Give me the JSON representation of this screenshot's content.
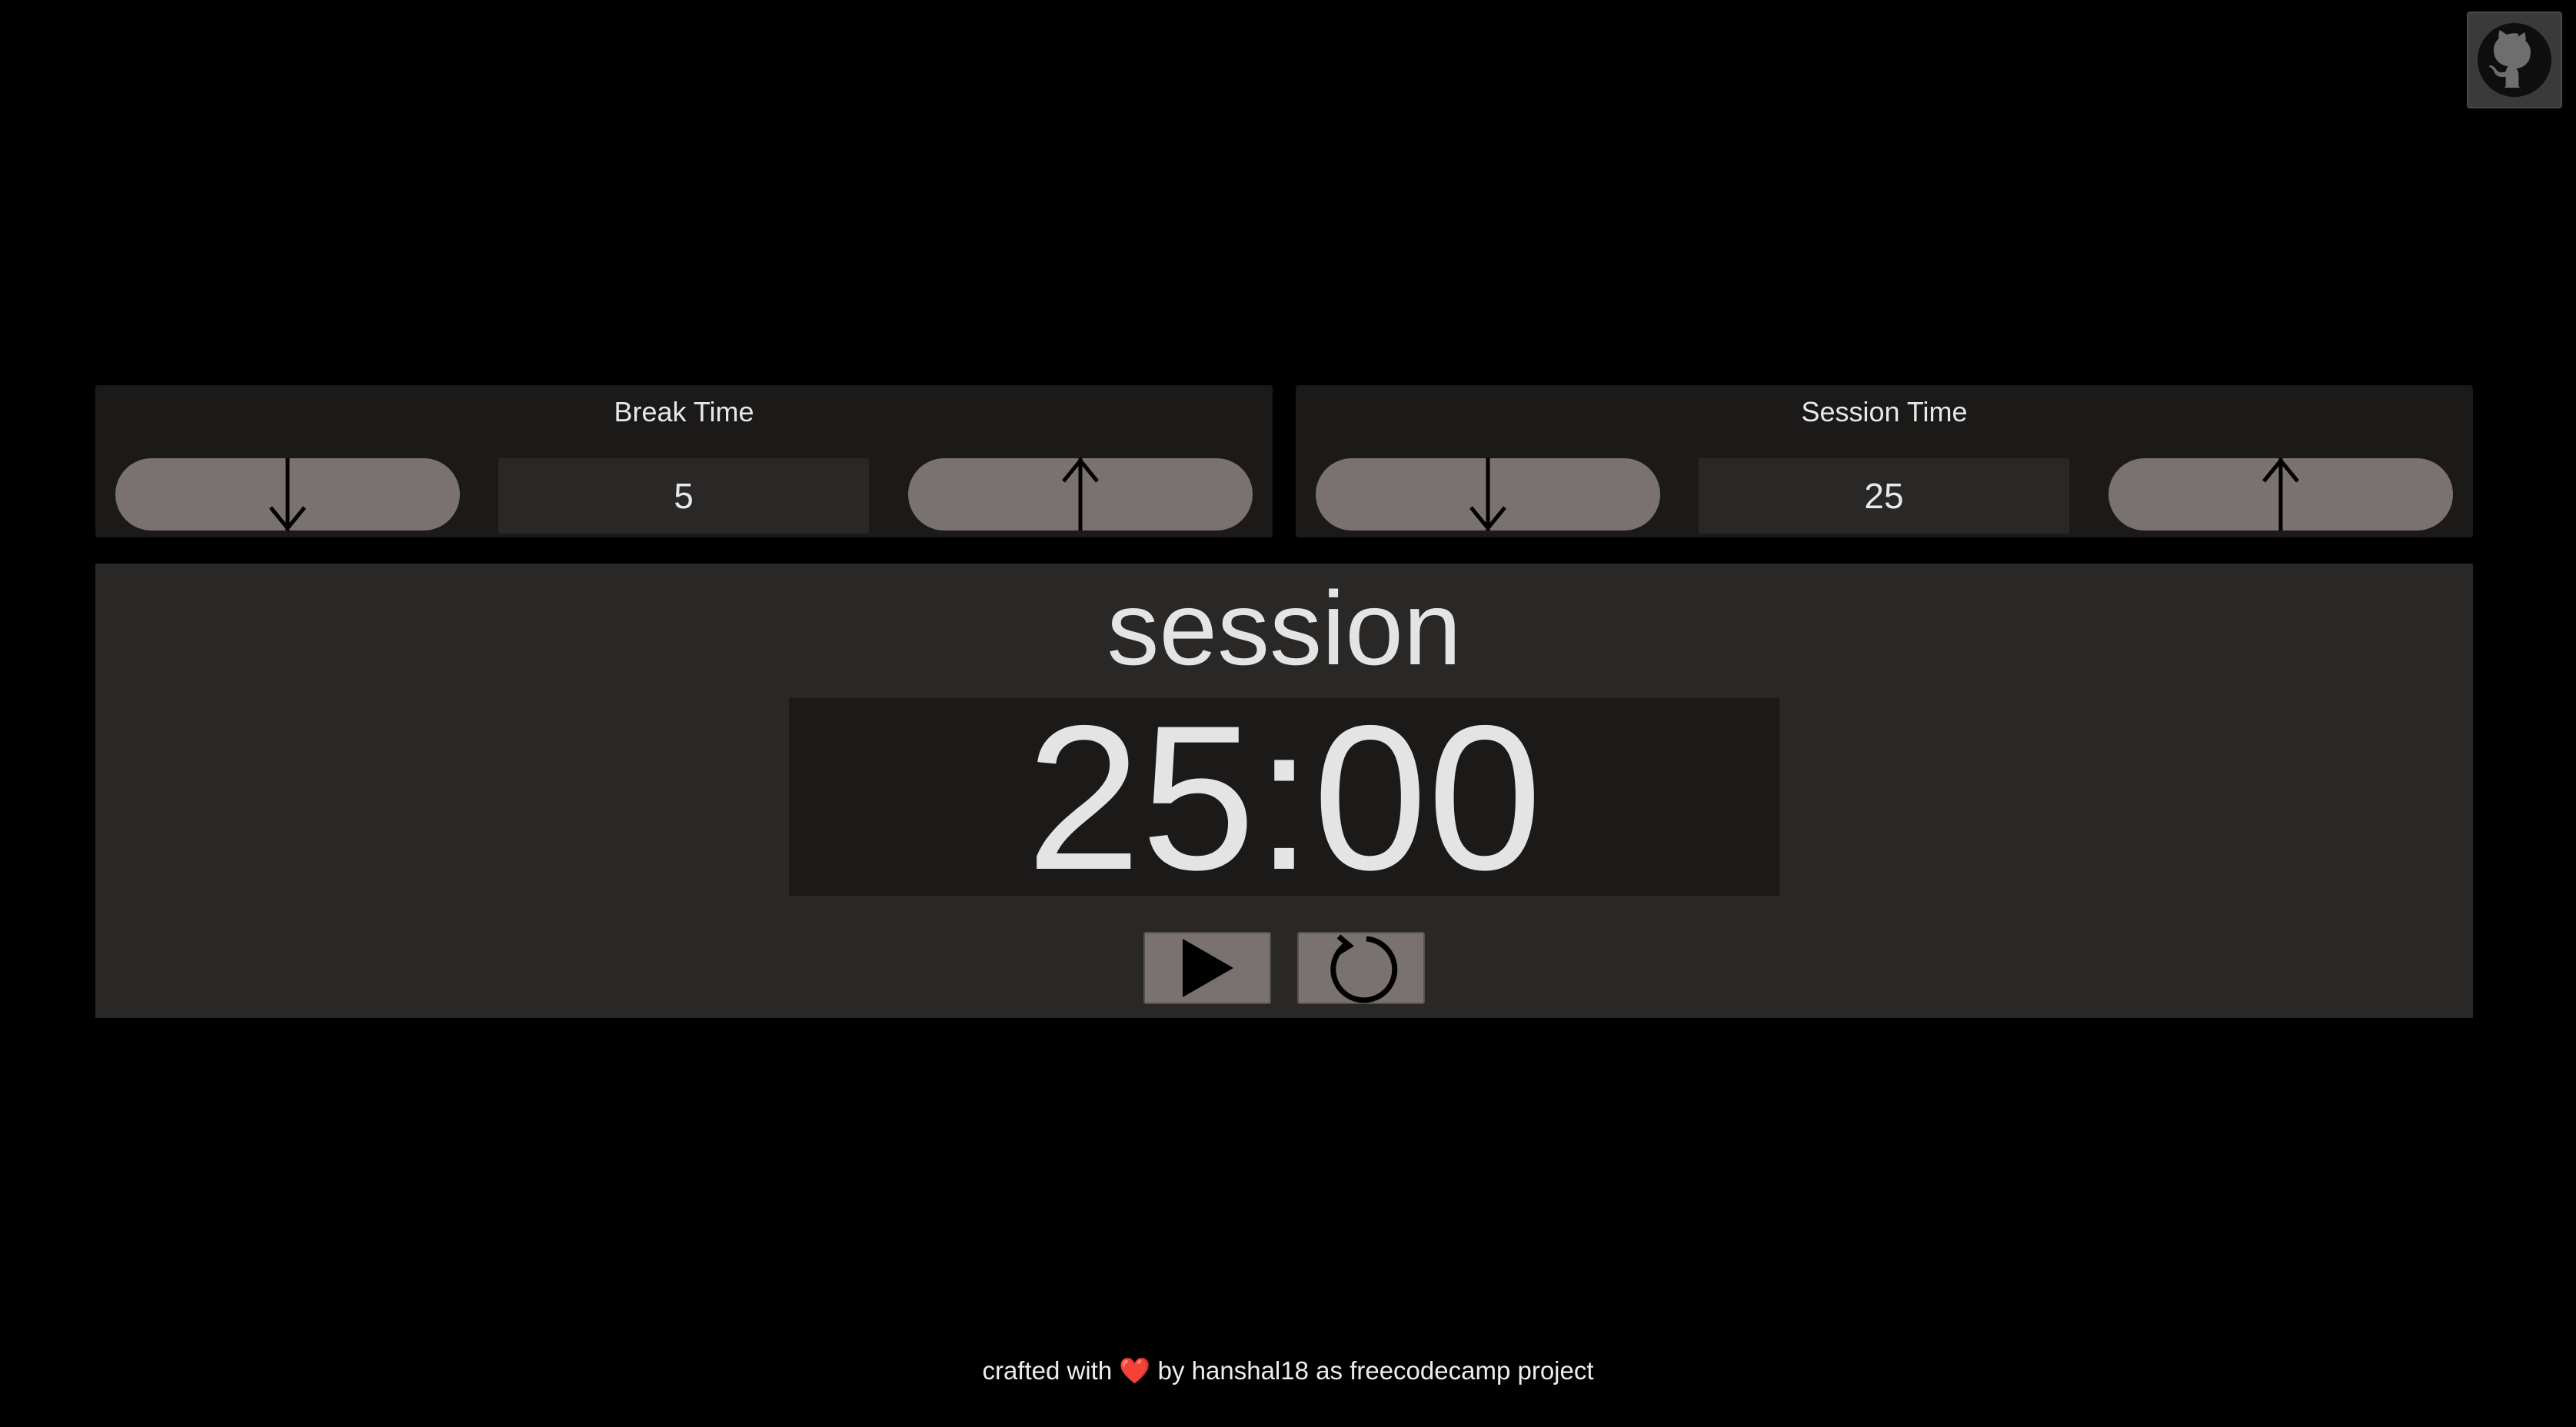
{
  "github": {
    "icon": "github-icon"
  },
  "break": {
    "title": "Break Time",
    "value": "5",
    "decrement_icon": "arrow-down-icon",
    "increment_icon": "arrow-up-icon"
  },
  "session": {
    "title": "Session Time",
    "value": "25",
    "decrement_icon": "arrow-down-icon",
    "increment_icon": "arrow-up-icon"
  },
  "timer": {
    "label": "session",
    "time": "25:00",
    "play_icon": "play-icon",
    "reset_icon": "reset-icon"
  },
  "footer": {
    "prefix": "crafted with",
    "heart": "❤️",
    "by": "by",
    "author": "hanshal18",
    "as": "as",
    "project": "freecodecamp project"
  },
  "colors": {
    "background": "#000000",
    "panel": "#1c1a19",
    "timer_panel": "#2a2827",
    "button": "#7a7270",
    "text": "#e8e8e8"
  }
}
